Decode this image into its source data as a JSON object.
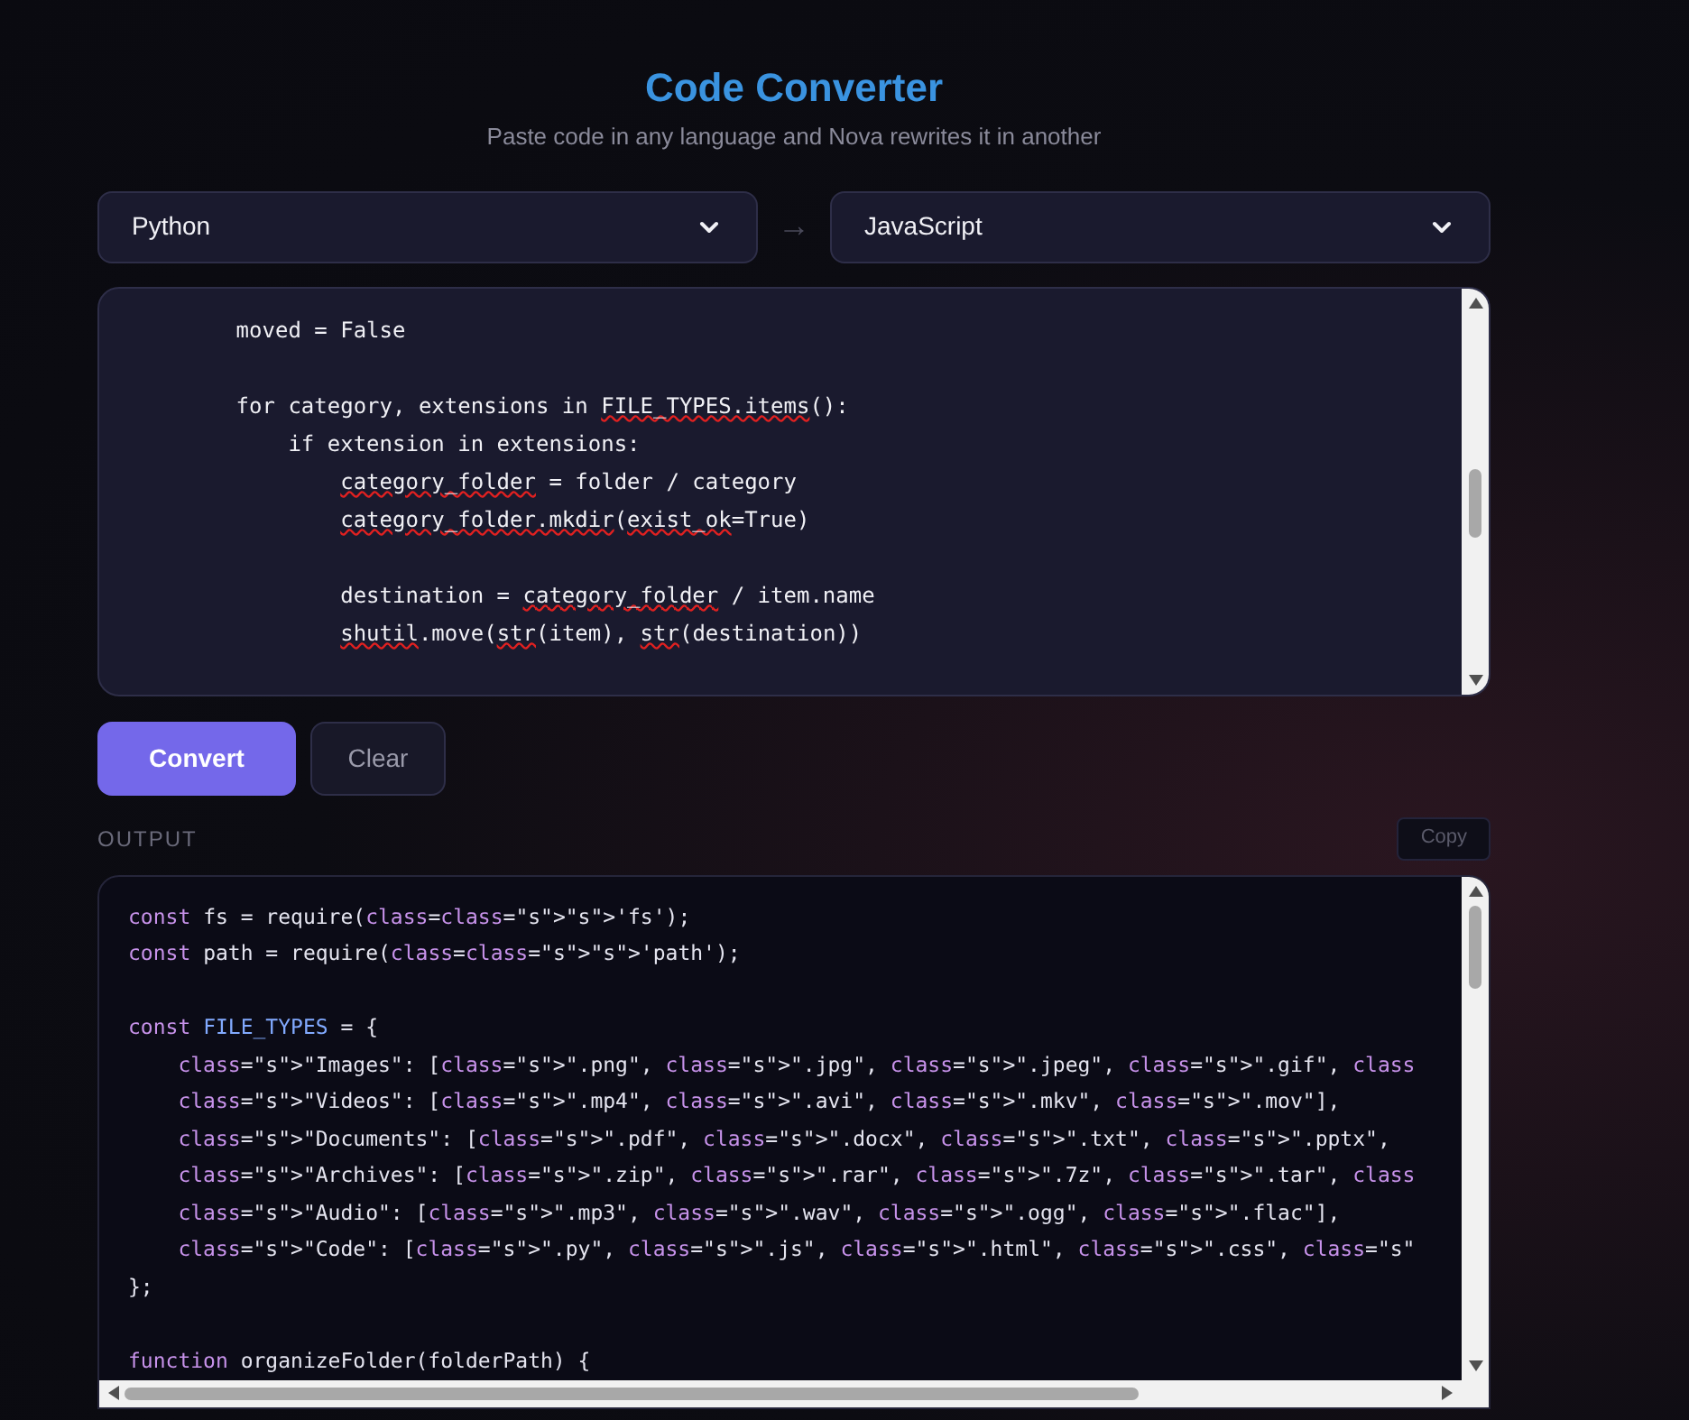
{
  "header": {
    "title": "Code Converter",
    "subtitle": "Paste code in any language and Nova rewrites it in another"
  },
  "languages": {
    "source": "Python",
    "arrow": "→",
    "target": "JavaScript"
  },
  "input_blocks": [
    [
      [
        {
          "text": "        moved = False",
          "flagged": false
        }
      ]
    ],
    [
      [
        {
          "text": "        for category, extensions in ",
          "flagged": false
        },
        {
          "text": "FILE_TYPES.items",
          "flagged": true
        },
        {
          "text": "():",
          "flagged": false
        }
      ],
      [
        {
          "text": "            if extension in extensions:",
          "flagged": false
        }
      ],
      [
        {
          "text": "                category_folder",
          "flagged": true
        },
        {
          "text": " = folder / category",
          "flagged": false
        }
      ],
      [
        {
          "text": "                category_folder.mkdir",
          "flagged": true
        },
        {
          "text": "(",
          "flagged": false
        },
        {
          "text": "exist_ok",
          "flagged": true
        },
        {
          "text": "=True)",
          "flagged": false
        }
      ]
    ],
    [
      [
        {
          "text": "                destination = ",
          "flagged": false
        },
        {
          "text": "category_folder",
          "flagged": true
        },
        {
          "text": " / item.name",
          "flagged": false
        }
      ],
      [
        {
          "text": "                shutil",
          "flagged": true
        },
        {
          "text": ".move(",
          "flagged": false
        },
        {
          "text": "str",
          "flagged": true
        },
        {
          "text": "(item), ",
          "flagged": false
        },
        {
          "text": "str",
          "flagged": true
        },
        {
          "text": "(destination))",
          "flagged": false
        }
      ]
    ]
  ],
  "actions": {
    "convert": "Convert",
    "clear": "Clear"
  },
  "output": {
    "label": "OUTPUT",
    "copy": "Copy",
    "blocks": [
      [
        [
          {
            "text": "const",
            "kind": "keyword"
          },
          {
            "text": " fs = require(",
            "kind": "plain"
          },
          {
            "text": "class",
            "kind": "keyword"
          },
          {
            "text": "=",
            "kind": "plain"
          },
          {
            "text": "class",
            "kind": "keyword"
          },
          {
            "text": "=\"s\">\"s\">'fs');",
            "kind": "plain"
          }
        ],
        [
          {
            "text": "const",
            "kind": "keyword"
          },
          {
            "text": " path = require(",
            "kind": "plain"
          },
          {
            "text": "class",
            "kind": "keyword"
          },
          {
            "text": "=",
            "kind": "plain"
          },
          {
            "text": "class",
            "kind": "keyword"
          },
          {
            "text": "=\"s\">\"s\">'path');",
            "kind": "plain"
          }
        ]
      ],
      [
        [
          {
            "text": "const",
            "kind": "keyword"
          },
          {
            "text": " FILE_TYPES",
            "kind": "constant"
          },
          {
            "text": " = {",
            "kind": "plain"
          }
        ],
        [
          {
            "text": "    class",
            "kind": "keyword"
          },
          {
            "text": "=\"s\">\"Images\": [",
            "kind": "plain"
          },
          {
            "text": "class",
            "kind": "keyword"
          },
          {
            "text": "=\"s\">\".png\", ",
            "kind": "plain"
          },
          {
            "text": "class",
            "kind": "keyword"
          },
          {
            "text": "=\"s\">\".jpg\", ",
            "kind": "plain"
          },
          {
            "text": "class",
            "kind": "keyword"
          },
          {
            "text": "=\"s\">\".jpeg\", ",
            "kind": "plain"
          },
          {
            "text": "class",
            "kind": "keyword"
          },
          {
            "text": "=\"s\">\".gif\", ",
            "kind": "plain"
          },
          {
            "text": "class",
            "kind": "keyword"
          }
        ],
        [
          {
            "text": "    class",
            "kind": "keyword"
          },
          {
            "text": "=\"s\">\"Videos\": [",
            "kind": "plain"
          },
          {
            "text": "class",
            "kind": "keyword"
          },
          {
            "text": "=\"s\">\".mp4\", ",
            "kind": "plain"
          },
          {
            "text": "class",
            "kind": "keyword"
          },
          {
            "text": "=\"s\">\".avi\", ",
            "kind": "plain"
          },
          {
            "text": "class",
            "kind": "keyword"
          },
          {
            "text": "=\"s\">\".mkv\", ",
            "kind": "plain"
          },
          {
            "text": "class",
            "kind": "keyword"
          },
          {
            "text": "=\"s\">\".mov\"],",
            "kind": "plain"
          }
        ],
        [
          {
            "text": "    class",
            "kind": "keyword"
          },
          {
            "text": "=\"s\">\"Documents\": [",
            "kind": "plain"
          },
          {
            "text": "class",
            "kind": "keyword"
          },
          {
            "text": "=\"s\">\".pdf\", ",
            "kind": "plain"
          },
          {
            "text": "class",
            "kind": "keyword"
          },
          {
            "text": "=\"s\">\".docx\", ",
            "kind": "plain"
          },
          {
            "text": "class",
            "kind": "keyword"
          },
          {
            "text": "=\"s\">\".txt\", ",
            "kind": "plain"
          },
          {
            "text": "class",
            "kind": "keyword"
          },
          {
            "text": "=\"s\">\".pptx\",",
            "kind": "plain"
          }
        ],
        [
          {
            "text": "    class",
            "kind": "keyword"
          },
          {
            "text": "=\"s\">\"Archives\": [",
            "kind": "plain"
          },
          {
            "text": "class",
            "kind": "keyword"
          },
          {
            "text": "=\"s\">\".zip\", ",
            "kind": "plain"
          },
          {
            "text": "class",
            "kind": "keyword"
          },
          {
            "text": "=\"s\">\".rar\", ",
            "kind": "plain"
          },
          {
            "text": "class",
            "kind": "keyword"
          },
          {
            "text": "=\"s\">\".7z\", ",
            "kind": "plain"
          },
          {
            "text": "class",
            "kind": "keyword"
          },
          {
            "text": "=\"s\">\".tar\", ",
            "kind": "plain"
          },
          {
            "text": "class",
            "kind": "keyword"
          }
        ],
        [
          {
            "text": "    class",
            "kind": "keyword"
          },
          {
            "text": "=\"s\">\"Audio\": [",
            "kind": "plain"
          },
          {
            "text": "class",
            "kind": "keyword"
          },
          {
            "text": "=\"s\">\".mp3\", ",
            "kind": "plain"
          },
          {
            "text": "class",
            "kind": "keyword"
          },
          {
            "text": "=\"s\">\".wav\", ",
            "kind": "plain"
          },
          {
            "text": "class",
            "kind": "keyword"
          },
          {
            "text": "=\"s\">\".ogg\", ",
            "kind": "plain"
          },
          {
            "text": "class",
            "kind": "keyword"
          },
          {
            "text": "=\"s\">\".flac\"],",
            "kind": "plain"
          }
        ],
        [
          {
            "text": "    class",
            "kind": "keyword"
          },
          {
            "text": "=\"s\">\"Code\": [",
            "kind": "plain"
          },
          {
            "text": "class",
            "kind": "keyword"
          },
          {
            "text": "=\"s\">\".py\", ",
            "kind": "plain"
          },
          {
            "text": "class",
            "kind": "keyword"
          },
          {
            "text": "=\"s\">\".js\", ",
            "kind": "plain"
          },
          {
            "text": "class",
            "kind": "keyword"
          },
          {
            "text": "=\"s\">\".html\", ",
            "kind": "plain"
          },
          {
            "text": "class",
            "kind": "keyword"
          },
          {
            "text": "=\"s\">\".css\", ",
            "kind": "plain"
          },
          {
            "text": "class",
            "kind": "keyword"
          },
          {
            "text": "=\"s\"",
            "kind": "plain"
          }
        ],
        [
          {
            "text": "};",
            "kind": "plain"
          }
        ]
      ],
      [
        [
          {
            "text": "function",
            "kind": "keyword"
          },
          {
            "text": " organizeFolder(folderPath) {",
            "kind": "plain"
          }
        ]
      ]
    ]
  }
}
